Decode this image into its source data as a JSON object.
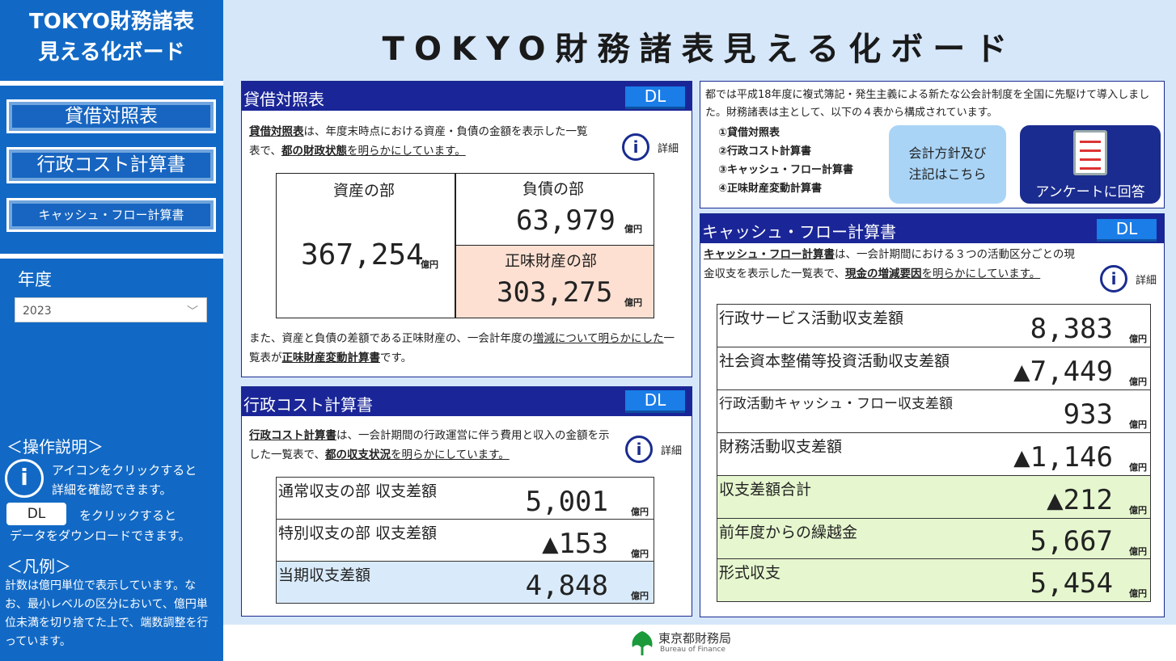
{
  "sidebar": {
    "title": "TOKYO財務諸表\n見える化ボード",
    "nav": [
      "貸借対照表",
      "行政コスト計算書",
      "キャッシュ・フロー計算書"
    ],
    "year_label": "年度",
    "year_value": "2023",
    "ops_heading": "＜操作説明＞",
    "ops_info_text": "アイコンをクリックすると\n詳細を確認できます。",
    "ops_dl_label": "DL",
    "ops_dl_text1": "をクリックすると",
    "ops_dl_text2": "データをダウンロードできます。",
    "legend_heading": "＜凡例＞",
    "legend_text": "計数は億円単位で表示しています。なお、最小レベルの区分において、億円単位未満を切り捨てた上で、端数調整を行っています。"
  },
  "main_title": "TOKYO財務諸表見える化ボード",
  "common": {
    "dl": "DL",
    "detail": "詳細",
    "info": "i",
    "unit": "億円"
  },
  "balance": {
    "title": "貸借対照表",
    "desc_bold": "貸借対照表",
    "desc_1": "は、年度末時点における資産・負債の金額を表示した一覧表で、",
    "desc_bold2": "都の財政状態",
    "desc_2": "を明らかにしています。",
    "assets_label": "資産の部",
    "assets_value": "367,254",
    "liab_label": "負債の部",
    "liab_value": "63,979",
    "net_label": "正味財産の部",
    "net_value": "303,275",
    "note_1": "また、資産と負債の差額である正味財産の、一会計年度の",
    "note_u": "増減について明らかにした",
    "note_2": "一覧表が",
    "note_bold": "正味財産変動計算書",
    "note_3": "です。"
  },
  "cost": {
    "title": "行政コスト計算書",
    "desc_bold": "行政コスト計算書",
    "desc_1": "は、一会計期間の行政運営に伴う費用と収入の金額を示した一覧表で、",
    "desc_bold2": "都の収支状況",
    "desc_2": "を明らかにしています。",
    "rows": [
      {
        "label": "通常収支の部 収支差額",
        "value": "5,001"
      },
      {
        "label": "特別収支の部 収支差額",
        "value": "▲153"
      },
      {
        "label": "当期収支差額",
        "value": "4,848"
      }
    ]
  },
  "intro": {
    "text": "都では平成18年度に複式簿記・発生主義による新たな公会計制度を全国に先駆けて導入しました。財務諸表は主として、以下の４表から構成されています。",
    "list": [
      "①貸借対照表",
      "②行政コスト計算書",
      "③キャッシュ・フロー計算書",
      "④正味財産変動計算書"
    ],
    "policy_btn": "会計方針及び\n注記はこちら",
    "survey_btn": "アンケートに回答"
  },
  "cashflow": {
    "title": "キャッシュ・フロー計算書",
    "desc_bold": "キャッシュ・フロー計算書",
    "desc_1": "は、一会計期間における３つの活動区分ごとの現金収支を表示した一覧表で、",
    "desc_bold2": "現金の増減要因",
    "desc_2": "を明らかにしています。",
    "rows": [
      {
        "label": "行政サービス活動収支差額",
        "value": "8,383"
      },
      {
        "label": "社会資本整備等投資活動収支差額",
        "value": "▲7,449"
      },
      {
        "label": "行政活動キャッシュ・フロー収支差額",
        "value": "933"
      },
      {
        "label": "財務活動収支差額",
        "value": "▲1,146"
      },
      {
        "label": "収支差額合計",
        "value": "▲212"
      },
      {
        "label": "前年度からの繰越金",
        "value": "5,667"
      },
      {
        "label": "形式収支",
        "value": "5,454"
      }
    ]
  },
  "footer": {
    "org": "東京都財務局",
    "org_en": "Bureau of Finance"
  }
}
